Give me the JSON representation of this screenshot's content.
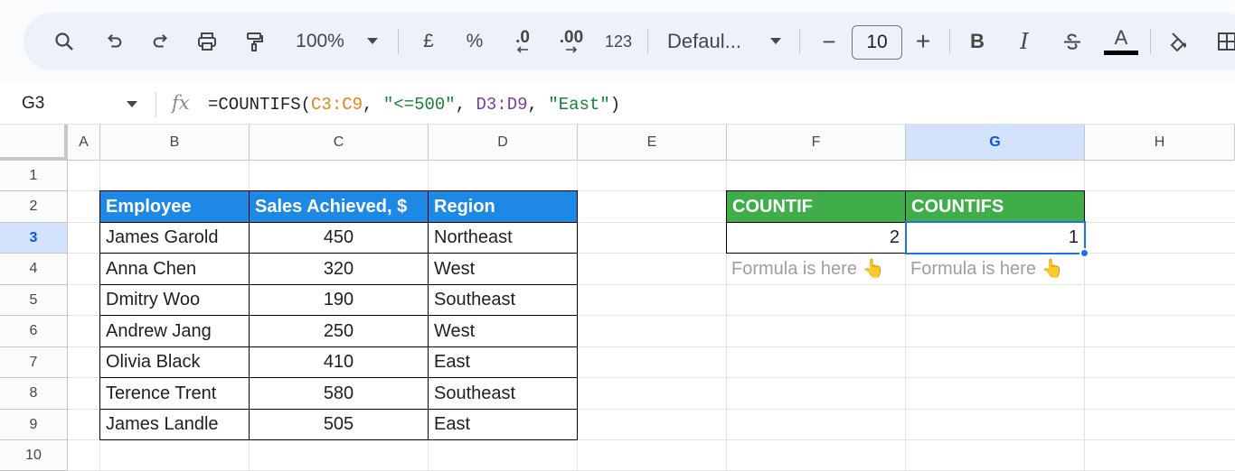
{
  "toolbar": {
    "zoom": "100%",
    "currency": "£",
    "percent": "%",
    "decrease_decimal": ".0",
    "increase_decimal": ".00",
    "number_format": "123",
    "font": "Defaul...",
    "font_size": "10",
    "minus": "−",
    "plus": "+",
    "bold": "B",
    "italic": "I",
    "text_color": "A"
  },
  "formula_bar": {
    "cell_ref": "G3",
    "fx": "fx",
    "f_prefix": "=COUNTIFS(",
    "f_range1": "C3:C9",
    "f_sep1": ", ",
    "f_crit1": "\"<=500\"",
    "f_sep2": ", ",
    "f_range2": "D3:D9",
    "f_sep3": ", ",
    "f_crit2": "\"East\"",
    "f_suffix": ")"
  },
  "columns": [
    "A",
    "B",
    "C",
    "D",
    "E",
    "F",
    "G",
    "H"
  ],
  "rows": [
    "1",
    "2",
    "3",
    "4",
    "5",
    "6",
    "7",
    "8",
    "9",
    "10"
  ],
  "table": {
    "headers": [
      "Employee",
      "Sales Achieved, $",
      "Region"
    ],
    "rows": [
      [
        "James Garold",
        "450",
        "Northeast"
      ],
      [
        "Anna Chen",
        "320",
        "West"
      ],
      [
        "Dmitry Woo",
        "190",
        "Southeast"
      ],
      [
        "Andrew Jang",
        "250",
        "West"
      ],
      [
        "Olivia Black",
        "410",
        "East"
      ],
      [
        "Terence Trent",
        "580",
        "Southeast"
      ],
      [
        "James Landle",
        "505",
        "East"
      ]
    ]
  },
  "results": {
    "headers": [
      "COUNTIF",
      "COUNTIFS"
    ],
    "values": [
      "2",
      "1"
    ],
    "hints": [
      "Formula is here 👆",
      "Formula is here 👆"
    ]
  },
  "colors": {
    "header_blue": "#1e88e5",
    "header_green": "#3fae49",
    "selection": "#1a73e8"
  }
}
